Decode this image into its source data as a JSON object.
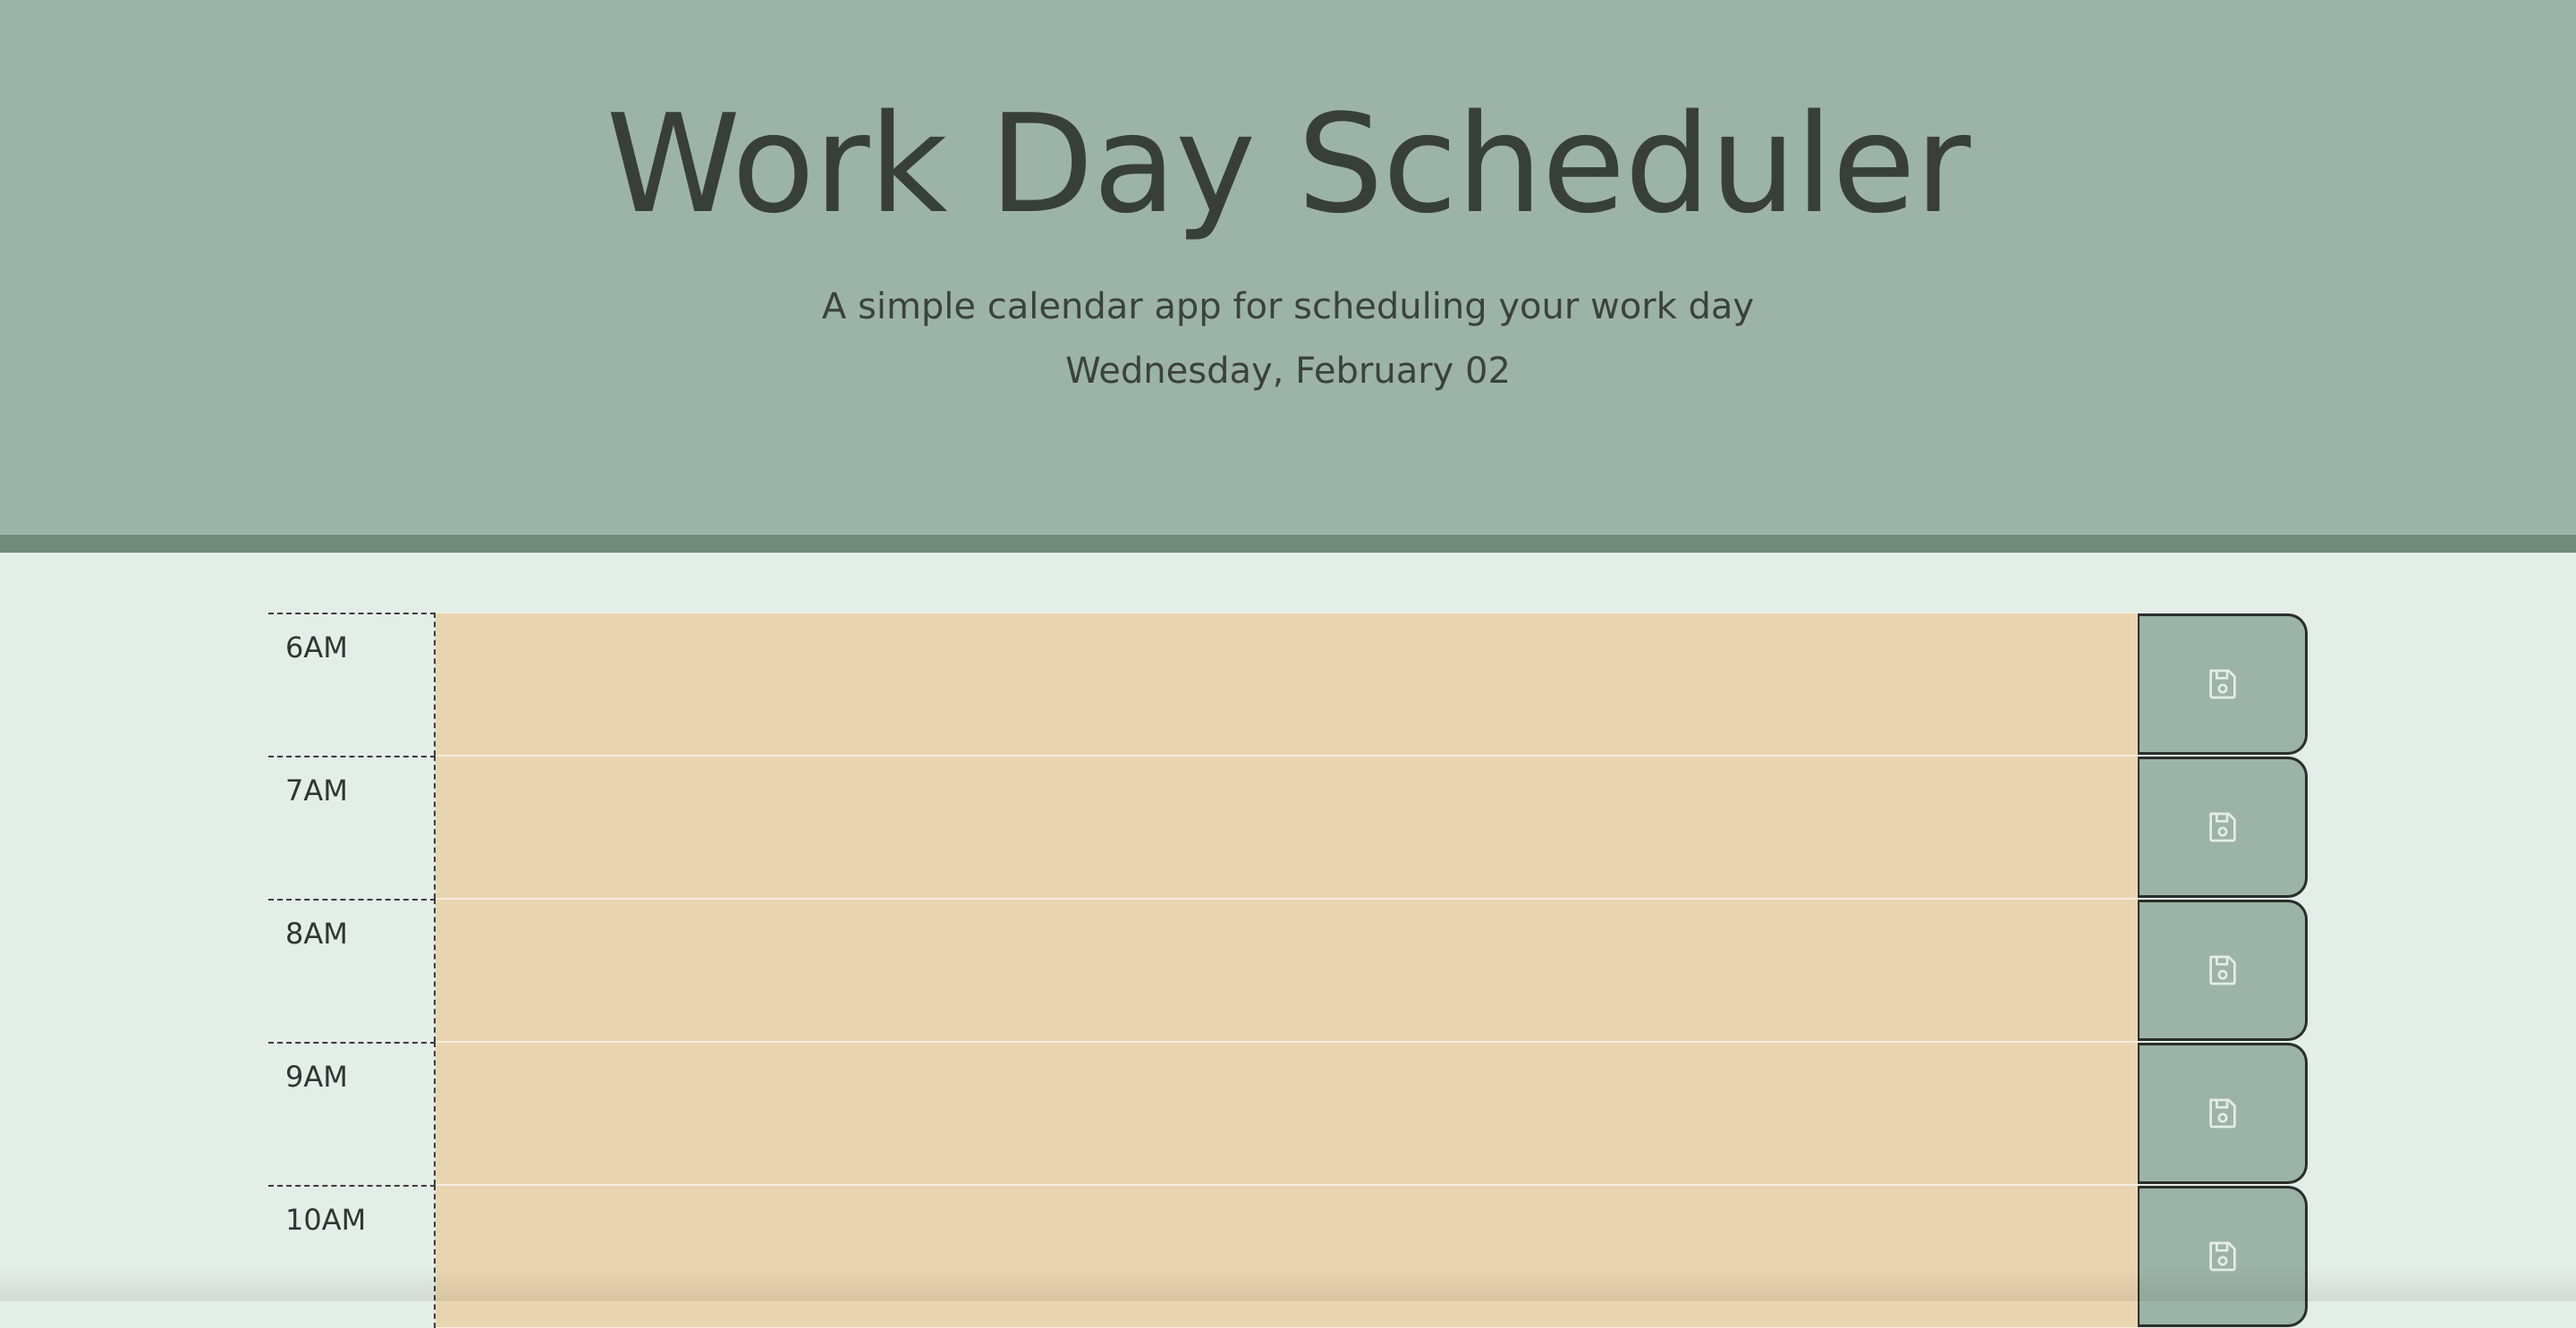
{
  "header": {
    "title": "Work Day Scheduler",
    "subtitle": "A simple calendar app for scheduling your work day",
    "current_day": "Wednesday, February 02"
  },
  "schedule": {
    "rows": [
      {
        "hour": "6AM",
        "description": ""
      },
      {
        "hour": "7AM",
        "description": ""
      },
      {
        "hour": "8AM",
        "description": ""
      },
      {
        "hour": "9AM",
        "description": ""
      },
      {
        "hour": "10AM",
        "description": ""
      }
    ],
    "save_icon": "floppy-disk-icon"
  },
  "colors": {
    "header_bg": "#9cb4a7",
    "header_border": "#708a7c",
    "page_bg": "#e3eee6",
    "future_block": "#ead5b1",
    "save_button": "#9cb4a7"
  }
}
